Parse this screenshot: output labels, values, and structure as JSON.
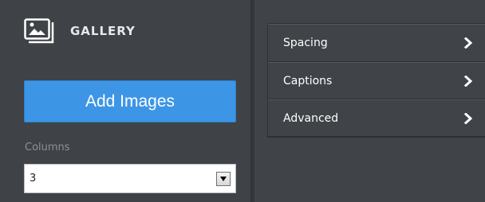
{
  "left_panel": {
    "header": {
      "title": "GALLERY",
      "icon": "gallery-icon"
    },
    "add_images_label": "Add Images",
    "columns": {
      "label": "Columns",
      "selected_value": "3"
    }
  },
  "right_panel": {
    "settings_items": [
      {
        "label": "Spacing",
        "icon": "chevron-right-icon"
      },
      {
        "label": "Captions",
        "icon": "chevron-right-icon"
      },
      {
        "label": "Advanced",
        "icon": "chevron-right-icon"
      }
    ]
  },
  "colors": {
    "panel_bg": "#404347",
    "accent_button": "#3d95e6",
    "text_primary": "#ffffff",
    "text_muted": "#8c9096"
  }
}
